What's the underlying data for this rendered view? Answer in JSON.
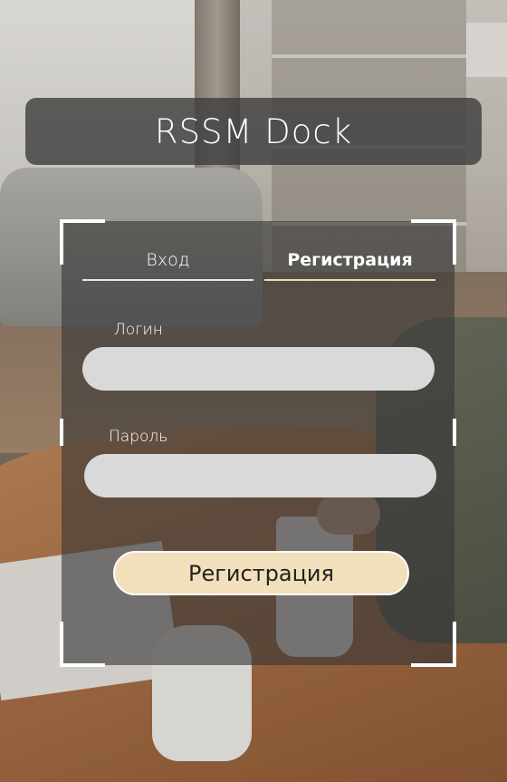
{
  "app": {
    "title": "RSSM Dock"
  },
  "tabs": {
    "login_label": "Вход",
    "register_label": "Регистрация",
    "active": "register"
  },
  "form": {
    "login": {
      "label": "Логин",
      "value": "",
      "placeholder": ""
    },
    "password": {
      "label": "Пароль",
      "value": "",
      "placeholder": ""
    },
    "submit_label": "Регистрация"
  },
  "colors": {
    "header_bg": "#404040",
    "panel_bg": "#373737",
    "field_bg": "#d9d9d9",
    "accent": "#f2dfbb",
    "text": "#ffffff"
  }
}
